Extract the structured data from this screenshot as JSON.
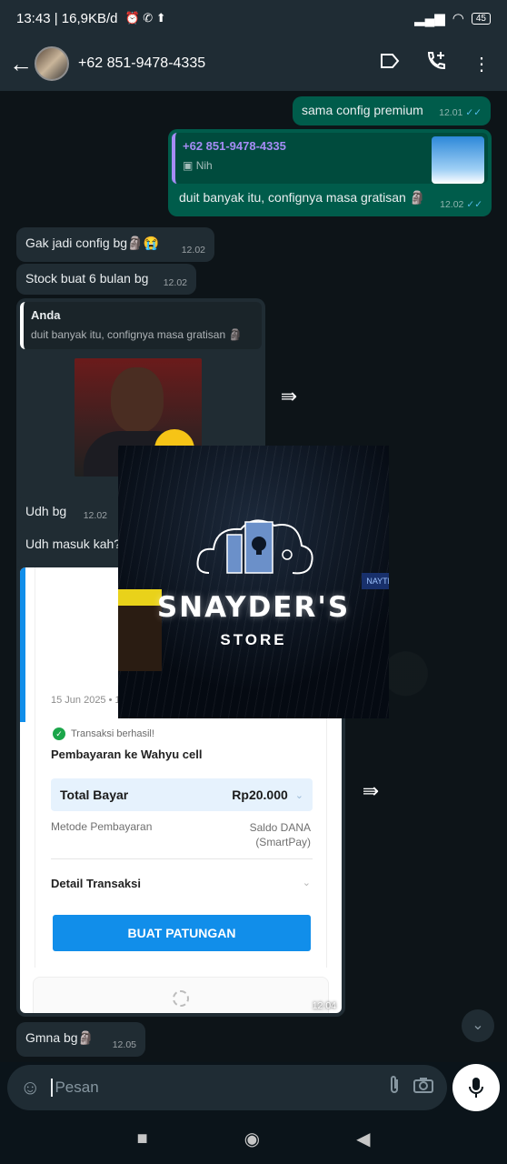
{
  "status_bar": {
    "time_and_speed": "13:43 | 16,9KB/d",
    "battery": "45"
  },
  "header": {
    "contact": "+62 851-9478-4335"
  },
  "messages": {
    "m1": {
      "text": "sama config premium",
      "time": "12.01"
    },
    "m2": {
      "quote_name": "+62 851-9478-4335",
      "quote_text": "Nih",
      "text": "duit banyak itu, confignya masa gratisan 🗿",
      "time": "12.02"
    },
    "m3": {
      "text": "Gak jadi config bg🗿😭",
      "time": "12.02"
    },
    "m4": {
      "text": "Stock buat 6 bulan bg",
      "time": "12.02"
    },
    "m5": {
      "quote_name": "Anda",
      "quote_text": "duit banyak itu, confignya masa gratisan 🗿"
    },
    "m6": {
      "text": "Udh bg",
      "time": "12.02"
    },
    "m7": {
      "text": "Udh masuk kah?"
    },
    "m8": {
      "text": "Gmna bg🗿",
      "time": "12.05"
    }
  },
  "overlay": {
    "brand": "SNAYDER'S",
    "sub": "STORE",
    "shop_sign": "NAYTE"
  },
  "receipt": {
    "date": "15 Jun 2025 • 1",
    "success": "Transaksi berhasil!",
    "payee": "Pembayaran ke Wahyu cell",
    "total_label": "Total Bayar",
    "total_amount": "Rp20.000",
    "method_label": "Metode Pembayaran",
    "method_value_1": "Saldo DANA",
    "method_value_2": "(SmartPay)",
    "detail_label": "Detail Transaksi",
    "button_label": "BUAT PATUNGAN",
    "time": "12.04"
  },
  "input": {
    "placeholder": "Pesan"
  },
  "icons": {
    "back": "arrow-left-icon",
    "label": "label-icon",
    "call": "add-call-icon",
    "menu": "more-vert-icon",
    "forward": "forward-icon",
    "emoji": "sticker-icon",
    "attach": "paperclip-icon",
    "camera": "camera-icon",
    "mic": "mic-icon",
    "scroll_down": "double-chevron-down-icon"
  },
  "colors": {
    "accent": "#005c4b",
    "incoming": "#202c33",
    "dana_blue": "#118eea"
  }
}
